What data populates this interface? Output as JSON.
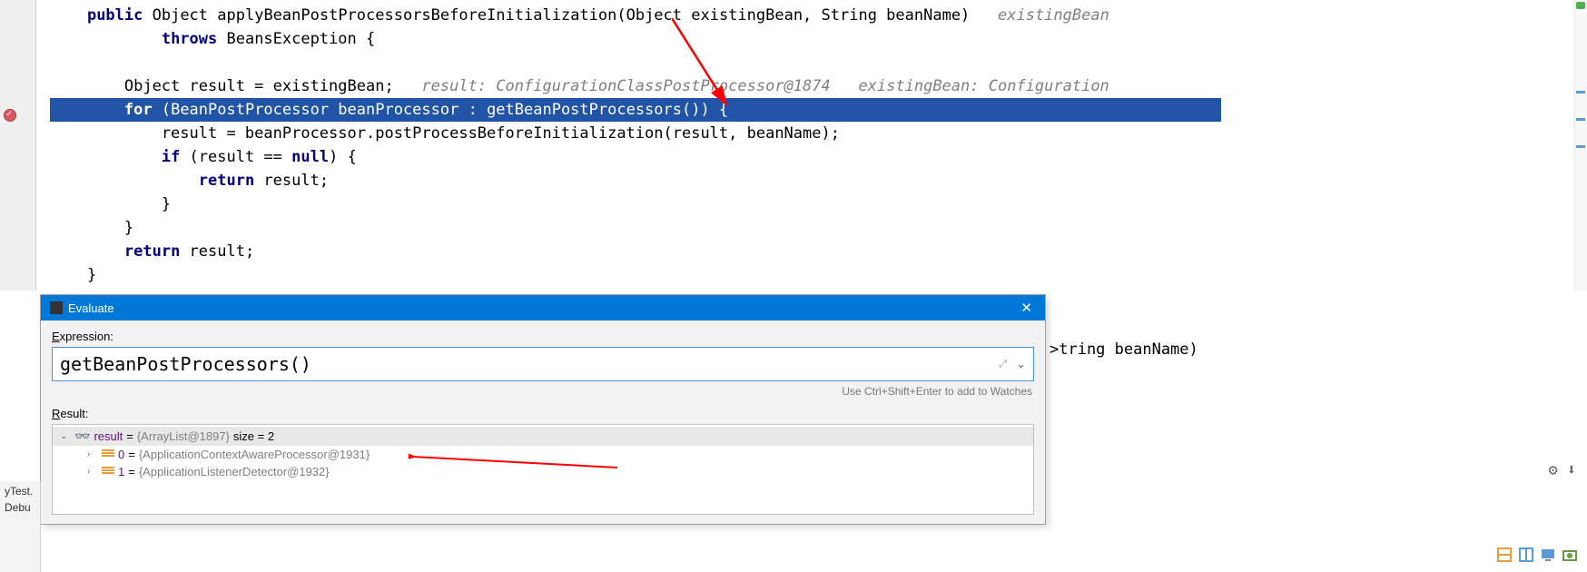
{
  "code": {
    "line1_pre": "    ",
    "kw_public": "public",
    "type_object": " Object ",
    "method_name": "applyBeanPostProcessorsBeforeInitialization(Object existingBean, String beanName)",
    "hint1": "   existingBean",
    "line2_indent": "            ",
    "kw_throws": "throws",
    "exc": " BeansException {",
    "line4_indent": "        Object result = existingBean;",
    "hint2": "   result: ConfigurationClassPostProcessor@1874   existingBean: Configuration",
    "line5_indent": "        ",
    "kw_for": "for",
    "for_rest": " (BeanPostProcessor beanProcessor : getBeanPostProcessors()) {",
    "line6": "            result = beanProcessor.postProcessBeforeInitialization(result, beanName);",
    "line7_indent": "            ",
    "kw_if": "if",
    "if_cond": " (result == ",
    "kw_null": "null",
    "if_end": ") {",
    "line8_indent": "                ",
    "kw_return1": "return",
    "ret1": " result;",
    "line9": "            }",
    "line10": "        }",
    "line11_indent": "        ",
    "kw_return2": "return",
    "ret2": " result;",
    "line12": "    }"
  },
  "behind_code": ">tring beanName)",
  "dialog": {
    "title": "Evaluate",
    "expression_label": "Expression:",
    "expression_value": "getBeanPostProcessors()",
    "hint": "Use Ctrl+Shift+Enter to add to Watches",
    "result_label": "Result:"
  },
  "result_tree": {
    "root_name": "result",
    "root_eq": " = ",
    "root_type": "{ArrayList@1897} ",
    "root_size": " size = 2",
    "item0_name": "0",
    "item0_eq": " = ",
    "item0_type": "{ApplicationContextAwareProcessor@1931}",
    "item1_name": "1",
    "item1_eq": " = ",
    "item1_type": "{ApplicationListenerDetector@1932}"
  },
  "tabs": {
    "test": "yTest.",
    "debug": "Debu"
  }
}
